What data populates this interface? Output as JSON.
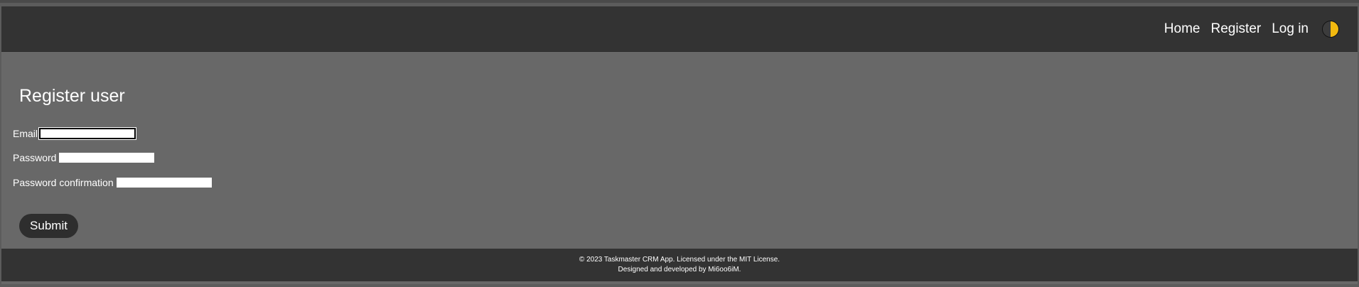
{
  "navbar": {
    "links": [
      "Home",
      "Register",
      "Log in"
    ],
    "theme_toggle_icon": "half-moon-icon"
  },
  "form": {
    "title": "Register user",
    "email_label": "Email",
    "password_label": "Password",
    "password_confirmation_label": "Password confirmation",
    "email_value": "",
    "password_value": "",
    "password_confirmation_value": "",
    "submit_label": "Submit"
  },
  "footer": {
    "line1": "© 2023 Taskmaster CRM App. Licensed under the MIT License.",
    "line2": "Designed and developed by Mi6oo6iM."
  },
  "colors": {
    "navbar_bg": "#333333",
    "content_bg": "#686868",
    "toggle_accent": "#f2b90f"
  }
}
